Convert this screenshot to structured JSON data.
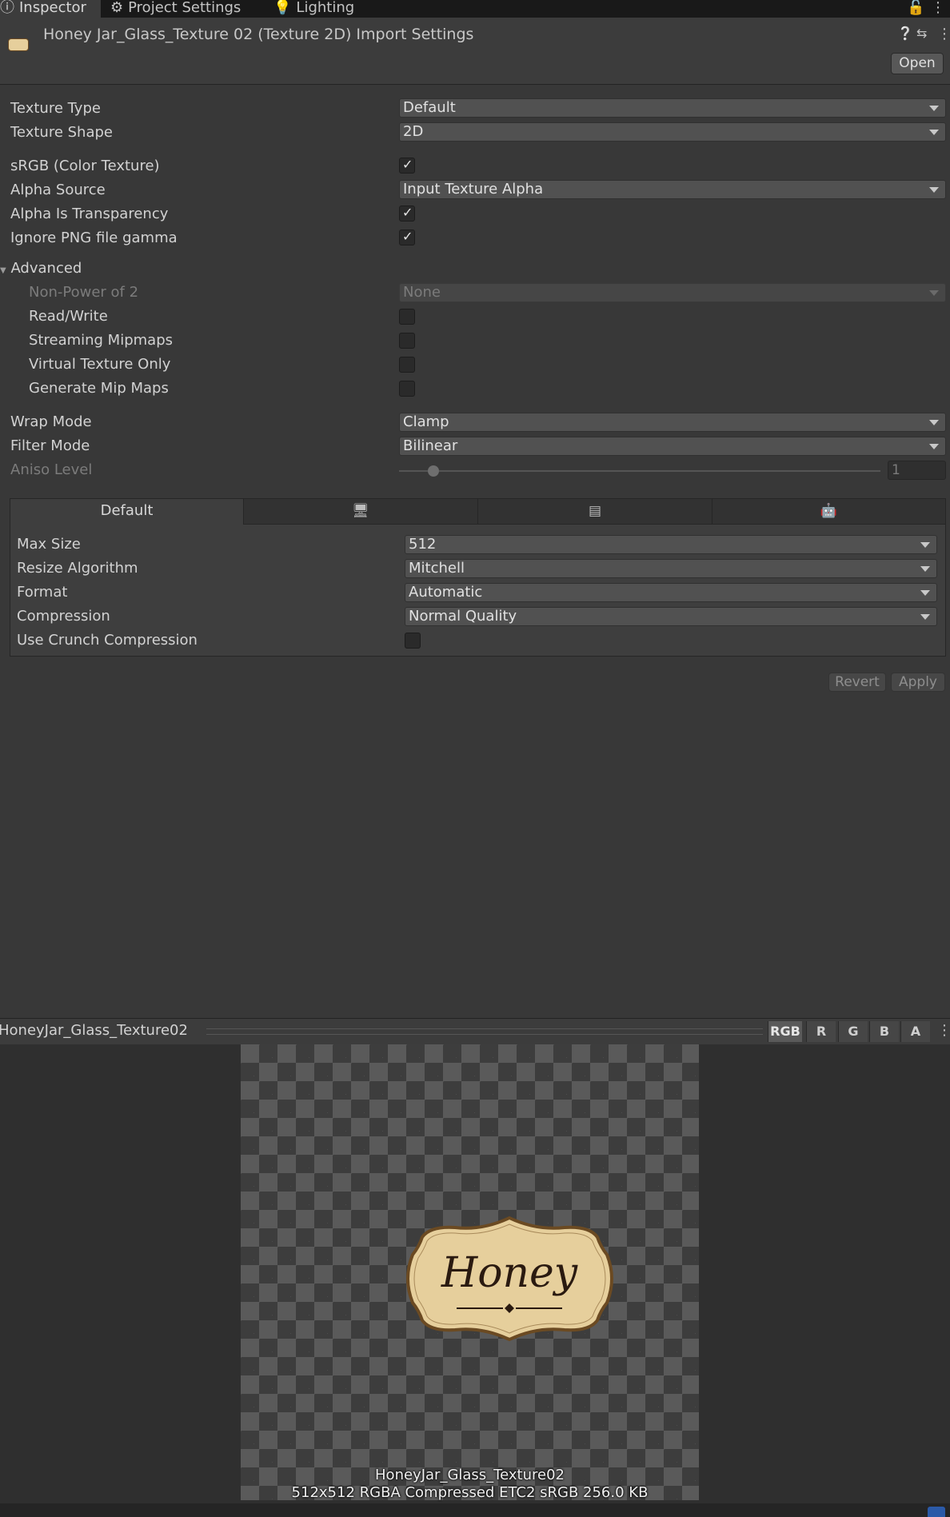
{
  "tabs": [
    {
      "label": "Inspector",
      "icon": "info-icon"
    },
    {
      "label": "Project Settings",
      "icon": "gear-icon"
    },
    {
      "label": "Lighting",
      "icon": "bulb-icon"
    }
  ],
  "header": {
    "title": "Honey Jar_Glass_Texture 02 (Texture 2D) Import Settings",
    "open_label": "Open"
  },
  "settings": {
    "texture_type": {
      "label": "Texture Type",
      "value": "Default"
    },
    "texture_shape": {
      "label": "Texture Shape",
      "value": "2D"
    },
    "srgb": {
      "label": "sRGB (Color Texture)",
      "checked": true
    },
    "alpha_source": {
      "label": "Alpha Source",
      "value": "Input Texture Alpha"
    },
    "alpha_is_transparency": {
      "label": "Alpha Is Transparency",
      "checked": true
    },
    "ignore_png_gamma": {
      "label": "Ignore PNG file gamma",
      "checked": true
    },
    "advanced": {
      "label": "Advanced",
      "non_power_of_2": {
        "label": "Non-Power of 2",
        "value": "None"
      },
      "read_write": {
        "label": "Read/Write",
        "checked": false
      },
      "streaming_mipmaps": {
        "label": "Streaming Mipmaps",
        "checked": false
      },
      "virtual_texture_only": {
        "label": "Virtual Texture Only",
        "checked": false
      },
      "generate_mip_maps": {
        "label": "Generate Mip Maps",
        "checked": false
      }
    },
    "wrap_mode": {
      "label": "Wrap Mode",
      "value": "Clamp"
    },
    "filter_mode": {
      "label": "Filter Mode",
      "value": "Bilinear"
    },
    "aniso_level": {
      "label": "Aniso Level",
      "value": "1",
      "fraction": 0.0
    }
  },
  "platform": {
    "tabs": [
      {
        "label": "Default",
        "icon": ""
      },
      {
        "label": "",
        "icon": "monitor-icon"
      },
      {
        "label": "",
        "icon": "server-icon"
      },
      {
        "label": "",
        "icon": "android-icon"
      }
    ],
    "max_size": {
      "label": "Max Size",
      "value": "512"
    },
    "resize_algorithm": {
      "label": "Resize Algorithm",
      "value": "Mitchell"
    },
    "format": {
      "label": "Format",
      "value": "Automatic"
    },
    "compression": {
      "label": "Compression",
      "value": "Normal Quality"
    },
    "crunch": {
      "label": "Use Crunch Compression",
      "checked": false
    }
  },
  "actions": {
    "revert_label": "Revert",
    "apply_label": "Apply"
  },
  "preview": {
    "name": "HoneyJar_Glass_Texture02",
    "channels": [
      "RGB",
      "R",
      "G",
      "B",
      "A"
    ],
    "label_text": "Honey",
    "caption_name": "HoneyJar_Glass_Texture02",
    "caption_info": "512x512  RGBA Compressed ETC2 sRGB   256.0 KB"
  },
  "colors": {
    "panel_bg": "#383838",
    "header_bg": "#3c3c3c",
    "label_fill": "#e6cf9c",
    "label_border": "#6b4a22"
  }
}
